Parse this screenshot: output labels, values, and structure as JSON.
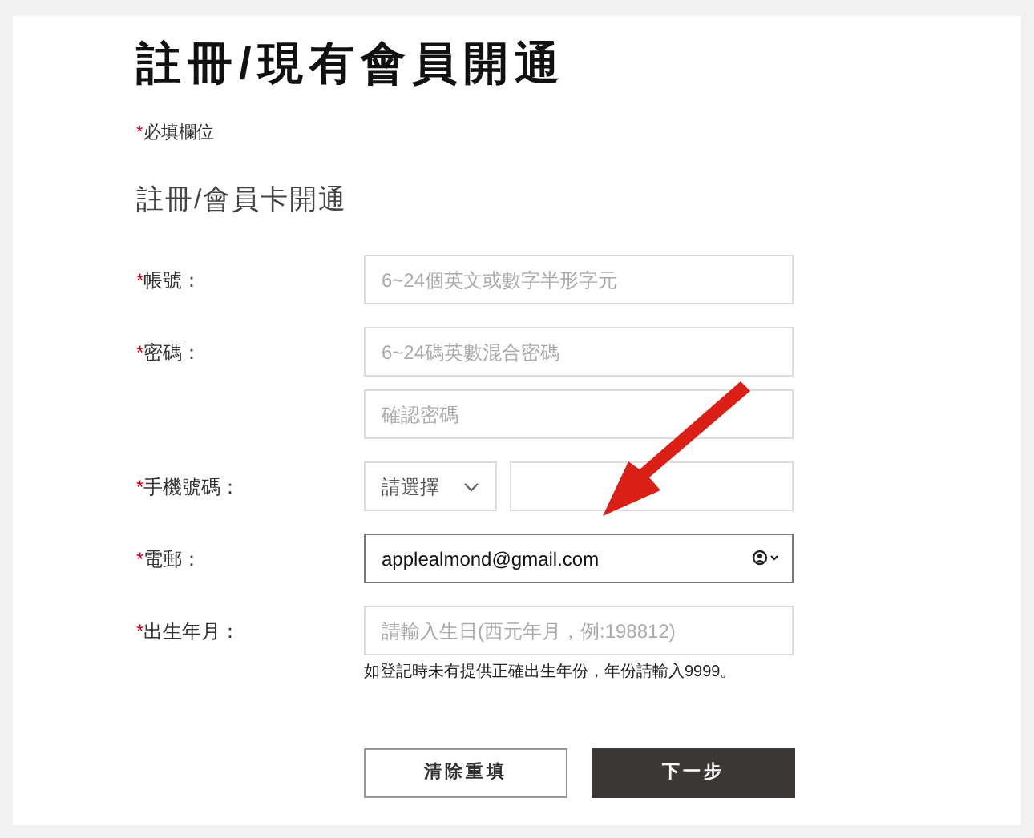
{
  "title": "註冊/現有會員開通",
  "required_mark": "*",
  "required_note": "必填欄位",
  "section_title": "註冊/會員卡開通",
  "fields": [
    {
      "label": "帳號：",
      "required": true,
      "kind": "text",
      "inputs": [
        {
          "placeholder": "6~24個英文或數字半形字元",
          "focused": false
        }
      ]
    },
    {
      "label": "密碼：",
      "required": true,
      "kind": "text",
      "inputs": [
        {
          "placeholder": "6~24碼英數混合密碼",
          "focused": false
        },
        {
          "placeholder": "確認密碼",
          "focused": false
        }
      ]
    },
    {
      "label": "手機號碼：",
      "required": true,
      "kind": "phone",
      "select": "請選擇",
      "inputs": [
        {
          "focused": false
        }
      ]
    },
    {
      "label": "電郵：",
      "required": true,
      "kind": "text",
      "inputs": [
        {
          "value": "applealmond@gmail.com",
          "focused": true,
          "autofill_icon": true
        }
      ]
    },
    {
      "label": "出生年月：",
      "required": true,
      "kind": "text",
      "inputs": [
        {
          "placeholder": "請輸入生日(西元年月，例:198812)",
          "focused": false
        }
      ],
      "hint": "如登記時未有提供正確出生年份，年份請輸入9999。"
    }
  ],
  "buttons": [
    {
      "label": "清除重填",
      "kind": "secondary"
    },
    {
      "label": "下一步",
      "kind": "primary"
    }
  ],
  "annotation_arrow": true
}
